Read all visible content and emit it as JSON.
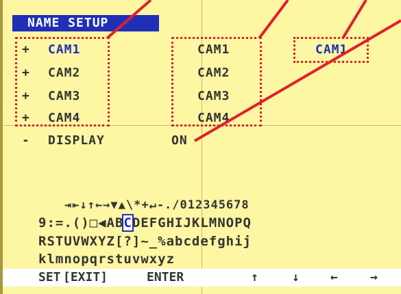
{
  "menu": {
    "title": "NAME SETUP",
    "camera_rows": [
      {
        "marker": "+",
        "name": "CAM1",
        "value": "CAM1"
      },
      {
        "marker": "+",
        "name": "CAM2",
        "value": "CAM2"
      },
      {
        "marker": "+",
        "name": "CAM3",
        "value": "CAM3"
      },
      {
        "marker": "+",
        "name": "CAM4",
        "value": "CAM4"
      }
    ],
    "preview_name": "CAM1",
    "display": {
      "marker": "-",
      "label": "DISPLAY",
      "value": "ON"
    }
  },
  "keyboard": {
    "row1": "⇥⇤↓↑←→▼▲\\*+↵-./012345678",
    "row2_pre": "9:=.()□◀AB",
    "row2_sel": "C",
    "row2_post": "DEFGHIJKLMNOPQ",
    "row3": "RSTUVWXYZ[?]~_%abcdefghij",
    "row4": "klmnopqrstuvwxyz"
  },
  "bottom_bar": {
    "set": "SET",
    "exit": "[EXIT]",
    "enter": "ENTER",
    "up": "↑",
    "down": "↓",
    "left": "←",
    "right": "→"
  },
  "colors": {
    "background": "#fdf6a3",
    "osd_blue": "#1f2fb8",
    "annotation_red": "#e0202a",
    "text": "#333333"
  }
}
